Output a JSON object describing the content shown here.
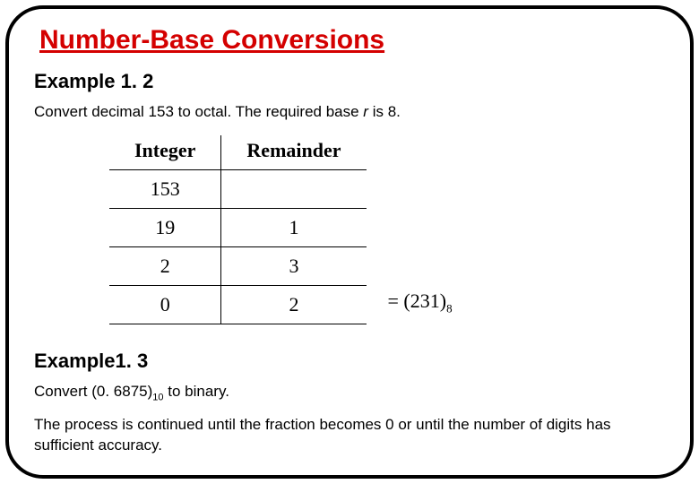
{
  "title": "Number-Base Conversions",
  "example12": {
    "heading": "Example 1. 2",
    "line_pre": "Convert decimal 153 to octal. The required base ",
    "line_var": "r",
    "line_post": " is 8."
  },
  "table": {
    "headers": {
      "integer": "Integer",
      "remainder": "Remainder"
    },
    "rows": [
      {
        "integer": "153",
        "remainder": ""
      },
      {
        "integer": "19",
        "remainder": "1"
      },
      {
        "integer": "2",
        "remainder": "3"
      },
      {
        "integer": "0",
        "remainder": "2"
      }
    ]
  },
  "result": {
    "eq": "= (231)",
    "base": "8"
  },
  "example13": {
    "heading": "Example1. 3",
    "line_pre": "Convert (0. 6875)",
    "line_sub": "10",
    "line_post": " to binary.",
    "note": "The process is continued until the fraction becomes 0 or until the number of digits has sufficient accuracy."
  },
  "chart_data": {
    "type": "table",
    "title": "Decimal 153 to Octal (base 8) by repeated division",
    "columns": [
      "Integer",
      "Remainder"
    ],
    "rows": [
      [
        153,
        null
      ],
      [
        19,
        1
      ],
      [
        2,
        3
      ],
      [
        0,
        2
      ]
    ],
    "result": "(231)_8"
  }
}
